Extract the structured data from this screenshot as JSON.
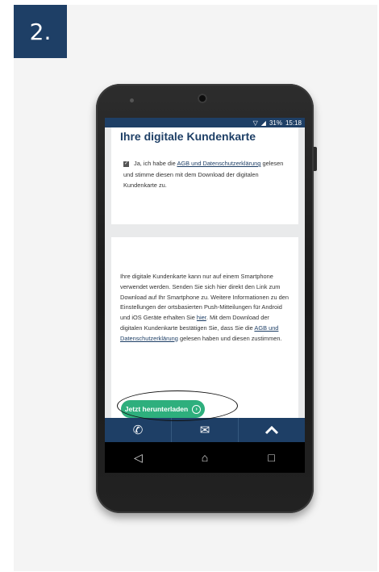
{
  "step": {
    "label": "2."
  },
  "status_bar": {
    "battery": "31%",
    "time": "15:18"
  },
  "card1": {
    "title": "Ihre digitale Kundenkarte",
    "consent_prefix": "Ja, ich habe die",
    "consent_link": "AGB und Datenschutzerklärung",
    "consent_suffix": "gelesen und stimme diesen mit dem Download der digitalen Kundenkarte zu."
  },
  "card2": {
    "text_part1": "Ihre digitale Kundenkarte kann nur auf einem Smartphone verwendet werden. Senden Sie sich hier direkt den Link zum Download auf Ihr Smartphone zu. Weitere Informationen zu den Einstellungen der ortsbasierten Push-Mitteilungen für Android und iOS Geräte erhalten Sie",
    "link_hier": "hier",
    "text_part2": ". Mit dem Download der digitalen Kundenkarte bestätigen Sie, dass Sie die",
    "link_agb": "AGB und Datenschutzerklärung",
    "text_part3": "gelesen haben und diesen zustimmen.",
    "download_label": "Jetzt herunterladen"
  },
  "toolbar": {
    "icons": [
      "phone-icon",
      "mail-icon",
      "chevron-up-icon"
    ]
  },
  "nav": {
    "icons": [
      "back-icon",
      "home-icon",
      "recents-icon"
    ]
  },
  "colors": {
    "brand": "#1e3f66",
    "accent": "#2eaf7d"
  }
}
